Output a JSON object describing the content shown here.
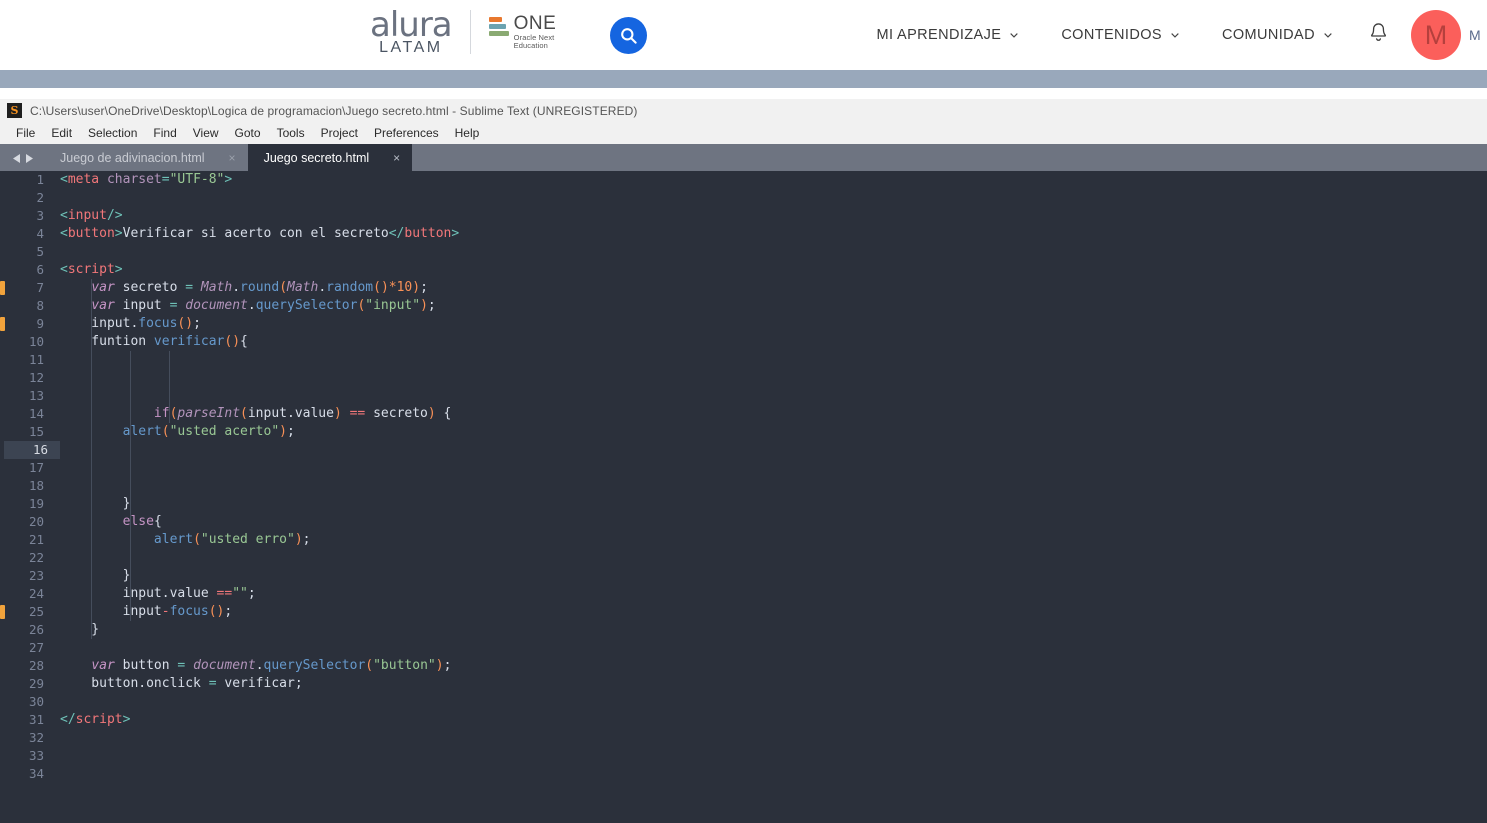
{
  "site_header": {
    "brand": {
      "name": "alura",
      "sub": "LATAM"
    },
    "partner": {
      "title": "ONE",
      "tagline_1": "Oracle Next",
      "tagline_2": "Education"
    },
    "search_icon": "search-icon",
    "nav_items": [
      {
        "label": "MI APRENDIZAJE",
        "caret": "chevron-down-icon"
      },
      {
        "label": "CONTENIDOS",
        "caret": "chevron-down-icon"
      },
      {
        "label": "COMUNIDAD",
        "caret": "chevron-down-icon"
      }
    ],
    "notifications_icon": "bell-icon",
    "avatar_initial": "M",
    "tail_text": "M",
    "colors": {
      "accent_blue": "#1565e0",
      "avatar": "#fb5f5b",
      "band": "#99a8bb"
    }
  },
  "sublime": {
    "title": "C:\\Users\\user\\OneDrive\\Desktop\\Logica de programacion\\Juego secreto.html - Sublime Text (UNREGISTERED)",
    "app_icon": "sublime-text-icon",
    "menu": [
      "File",
      "Edit",
      "Selection",
      "Find",
      "View",
      "Goto",
      "Tools",
      "Project",
      "Preferences",
      "Help"
    ],
    "tab_nav": {
      "prev": "caret-left-icon",
      "next": "caret-right-icon"
    },
    "tabs": [
      {
        "label": "Juego de adivinacion.html",
        "active": false,
        "close": "×"
      },
      {
        "label": "Juego secreto.html",
        "active": true,
        "close": "×"
      }
    ],
    "current_line": 16,
    "total_lines": 34,
    "fold_marks": [
      7,
      9,
      25
    ],
    "line_numbers": [
      1,
      2,
      3,
      4,
      5,
      6,
      7,
      8,
      9,
      10,
      11,
      12,
      13,
      14,
      15,
      16,
      17,
      18,
      19,
      20,
      21,
      22,
      23,
      24,
      25,
      26,
      27,
      28,
      29,
      30,
      31,
      32,
      33,
      34
    ],
    "code_lines": [
      {
        "n": 1,
        "tokens": [
          {
            "t": "<",
            "c": "c-punct"
          },
          {
            "t": "meta",
            "c": "c-tag"
          },
          {
            "t": " ",
            "c": "c-plain"
          },
          {
            "t": "charset",
            "c": "c-attr"
          },
          {
            "t": "=",
            "c": "c-punct"
          },
          {
            "t": "\"UTF-8\"",
            "c": "c-str"
          },
          {
            "t": ">",
            "c": "c-punct"
          }
        ]
      },
      {
        "n": 2,
        "tokens": []
      },
      {
        "n": 3,
        "tokens": [
          {
            "t": "<",
            "c": "c-punct"
          },
          {
            "t": "input",
            "c": "c-tag"
          },
          {
            "t": "/>",
            "c": "c-punct"
          }
        ]
      },
      {
        "n": 4,
        "tokens": [
          {
            "t": "<",
            "c": "c-punct"
          },
          {
            "t": "button",
            "c": "c-tag"
          },
          {
            "t": ">",
            "c": "c-punct"
          },
          {
            "t": "Verificar si acerto con el secreto",
            "c": "c-plain"
          },
          {
            "t": "</",
            "c": "c-punct"
          },
          {
            "t": "button",
            "c": "c-tag"
          },
          {
            "t": ">",
            "c": "c-punct"
          }
        ]
      },
      {
        "n": 5,
        "tokens": []
      },
      {
        "n": 6,
        "tokens": [
          {
            "t": "<",
            "c": "c-punct"
          },
          {
            "t": "script",
            "c": "c-tag"
          },
          {
            "t": ">",
            "c": "c-punct"
          }
        ]
      },
      {
        "n": 7,
        "tokens": [
          {
            "t": "    ",
            "c": "c-plain"
          },
          {
            "t": "var",
            "c": "c-kw"
          },
          {
            "t": " secreto ",
            "c": "c-plain"
          },
          {
            "t": "=",
            "c": "c-punct"
          },
          {
            "t": " ",
            "c": "c-plain"
          },
          {
            "t": "Math",
            "c": "c-cls"
          },
          {
            "t": ".",
            "c": "c-plain"
          },
          {
            "t": "round",
            "c": "c-fn"
          },
          {
            "t": "(",
            "c": "c-paren"
          },
          {
            "t": "Math",
            "c": "c-cls"
          },
          {
            "t": ".",
            "c": "c-plain"
          },
          {
            "t": "random",
            "c": "c-fn"
          },
          {
            "t": "()",
            "c": "c-paren"
          },
          {
            "t": "*10",
            "c": "c-num"
          },
          {
            "t": ")",
            "c": "c-paren"
          },
          {
            "t": ";",
            "c": "c-plain"
          }
        ]
      },
      {
        "n": 8,
        "tokens": [
          {
            "t": "    ",
            "c": "c-plain"
          },
          {
            "t": "var",
            "c": "c-kw"
          },
          {
            "t": " input ",
            "c": "c-plain"
          },
          {
            "t": "=",
            "c": "c-punct"
          },
          {
            "t": " ",
            "c": "c-plain"
          },
          {
            "t": "document",
            "c": "c-cls"
          },
          {
            "t": ".",
            "c": "c-plain"
          },
          {
            "t": "querySelector",
            "c": "c-fn"
          },
          {
            "t": "(",
            "c": "c-paren"
          },
          {
            "t": "\"input\"",
            "c": "c-str"
          },
          {
            "t": ")",
            "c": "c-paren"
          },
          {
            "t": ";",
            "c": "c-plain"
          }
        ]
      },
      {
        "n": 9,
        "tokens": [
          {
            "t": "    input.",
            "c": "c-plain"
          },
          {
            "t": "focus",
            "c": "c-fn"
          },
          {
            "t": "()",
            "c": "c-paren"
          },
          {
            "t": ";",
            "c": "c-plain"
          }
        ]
      },
      {
        "n": 10,
        "tokens": [
          {
            "t": "    funtion ",
            "c": "c-plain"
          },
          {
            "t": "verificar",
            "c": "c-fn"
          },
          {
            "t": "()",
            "c": "c-paren"
          },
          {
            "t": "{",
            "c": "c-plain"
          }
        ]
      },
      {
        "n": 11,
        "tokens": []
      },
      {
        "n": 12,
        "tokens": []
      },
      {
        "n": 13,
        "tokens": []
      },
      {
        "n": 14,
        "tokens": [
          {
            "t": "            ",
            "c": "c-plain"
          },
          {
            "t": "if",
            "c": "c-kw2"
          },
          {
            "t": "(",
            "c": "c-paren"
          },
          {
            "t": "parseInt",
            "c": "c-cls"
          },
          {
            "t": "(",
            "c": "c-paren"
          },
          {
            "t": "input.value",
            "c": "c-plain"
          },
          {
            "t": ")",
            "c": "c-paren"
          },
          {
            "t": " ",
            "c": "c-plain"
          },
          {
            "t": "==",
            "c": "c-op"
          },
          {
            "t": " secreto",
            "c": "c-plain"
          },
          {
            "t": ")",
            "c": "c-paren"
          },
          {
            "t": " {",
            "c": "c-plain"
          }
        ]
      },
      {
        "n": 15,
        "tokens": [
          {
            "t": "        ",
            "c": "c-plain"
          },
          {
            "t": "alert",
            "c": "c-fn"
          },
          {
            "t": "(",
            "c": "c-paren"
          },
          {
            "t": "\"usted acerto\"",
            "c": "c-str"
          },
          {
            "t": ")",
            "c": "c-paren"
          },
          {
            "t": ";",
            "c": "c-plain"
          }
        ]
      },
      {
        "n": 16,
        "tokens": []
      },
      {
        "n": 17,
        "tokens": []
      },
      {
        "n": 18,
        "tokens": []
      },
      {
        "n": 19,
        "tokens": [
          {
            "t": "        }",
            "c": "c-plain"
          }
        ]
      },
      {
        "n": 20,
        "tokens": [
          {
            "t": "        ",
            "c": "c-plain"
          },
          {
            "t": "else",
            "c": "c-kw2"
          },
          {
            "t": "{",
            "c": "c-plain"
          }
        ]
      },
      {
        "n": 21,
        "tokens": [
          {
            "t": "            ",
            "c": "c-plain"
          },
          {
            "t": "alert",
            "c": "c-fn"
          },
          {
            "t": "(",
            "c": "c-paren"
          },
          {
            "t": "\"usted erro\"",
            "c": "c-str"
          },
          {
            "t": ")",
            "c": "c-paren"
          },
          {
            "t": ";",
            "c": "c-plain"
          }
        ]
      },
      {
        "n": 22,
        "tokens": []
      },
      {
        "n": 23,
        "tokens": [
          {
            "t": "        }",
            "c": "c-plain"
          }
        ]
      },
      {
        "n": 24,
        "tokens": [
          {
            "t": "        input.value ",
            "c": "c-plain"
          },
          {
            "t": "==",
            "c": "c-op"
          },
          {
            "t": "\"\"",
            "c": "c-str"
          },
          {
            "t": ";",
            "c": "c-plain"
          }
        ]
      },
      {
        "n": 25,
        "tokens": [
          {
            "t": "        input",
            "c": "c-plain"
          },
          {
            "t": "-",
            "c": "c-op"
          },
          {
            "t": "focus",
            "c": "c-fn"
          },
          {
            "t": "()",
            "c": "c-paren"
          },
          {
            "t": ";",
            "c": "c-plain"
          }
        ]
      },
      {
        "n": 26,
        "tokens": [
          {
            "t": "    }",
            "c": "c-plain"
          }
        ]
      },
      {
        "n": 27,
        "tokens": []
      },
      {
        "n": 28,
        "tokens": [
          {
            "t": "    ",
            "c": "c-plain"
          },
          {
            "t": "var",
            "c": "c-kw"
          },
          {
            "t": " button ",
            "c": "c-plain"
          },
          {
            "t": "=",
            "c": "c-punct"
          },
          {
            "t": " ",
            "c": "c-plain"
          },
          {
            "t": "document",
            "c": "c-cls"
          },
          {
            "t": ".",
            "c": "c-plain"
          },
          {
            "t": "querySelector",
            "c": "c-fn"
          },
          {
            "t": "(",
            "c": "c-paren"
          },
          {
            "t": "\"button\"",
            "c": "c-str"
          },
          {
            "t": ")",
            "c": "c-paren"
          },
          {
            "t": ";",
            "c": "c-plain"
          }
        ]
      },
      {
        "n": 29,
        "tokens": [
          {
            "t": "    button.onclick ",
            "c": "c-plain"
          },
          {
            "t": "=",
            "c": "c-punct"
          },
          {
            "t": " verificar;",
            "c": "c-plain"
          }
        ]
      },
      {
        "n": 30,
        "tokens": []
      },
      {
        "n": 31,
        "tokens": [
          {
            "t": "</",
            "c": "c-punct"
          },
          {
            "t": "script",
            "c": "c-tag"
          },
          {
            "t": ">",
            "c": "c-punct"
          }
        ]
      },
      {
        "n": 32,
        "tokens": []
      },
      {
        "n": 33,
        "tokens": []
      },
      {
        "n": 34,
        "tokens": []
      }
    ]
  }
}
